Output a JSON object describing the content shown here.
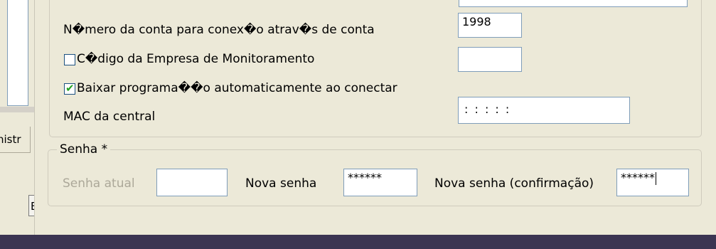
{
  "background_window": {
    "tab_fragment": "nistr",
    "button_fragment": "E"
  },
  "form": {
    "account_number_label": "N�mero da conta para conex�o atrav�s de conta",
    "account_number_value": "1998",
    "monitoring_company_label": "C�digo da Empresa de Monitoramento",
    "monitoring_company_checked": false,
    "monitoring_company_value": "",
    "auto_download_label": "Baixar programa��o automaticamente ao conectar",
    "auto_download_checked": true,
    "mac_label": "MAC da central",
    "mac_value": ": : : : :"
  },
  "senha": {
    "legend": "Senha *",
    "current_label": "Senha atual",
    "current_value": "",
    "new_label": "Nova senha",
    "new_value": "******",
    "confirm_label": "Nova senha (confirmação)",
    "confirm_value": "******"
  }
}
